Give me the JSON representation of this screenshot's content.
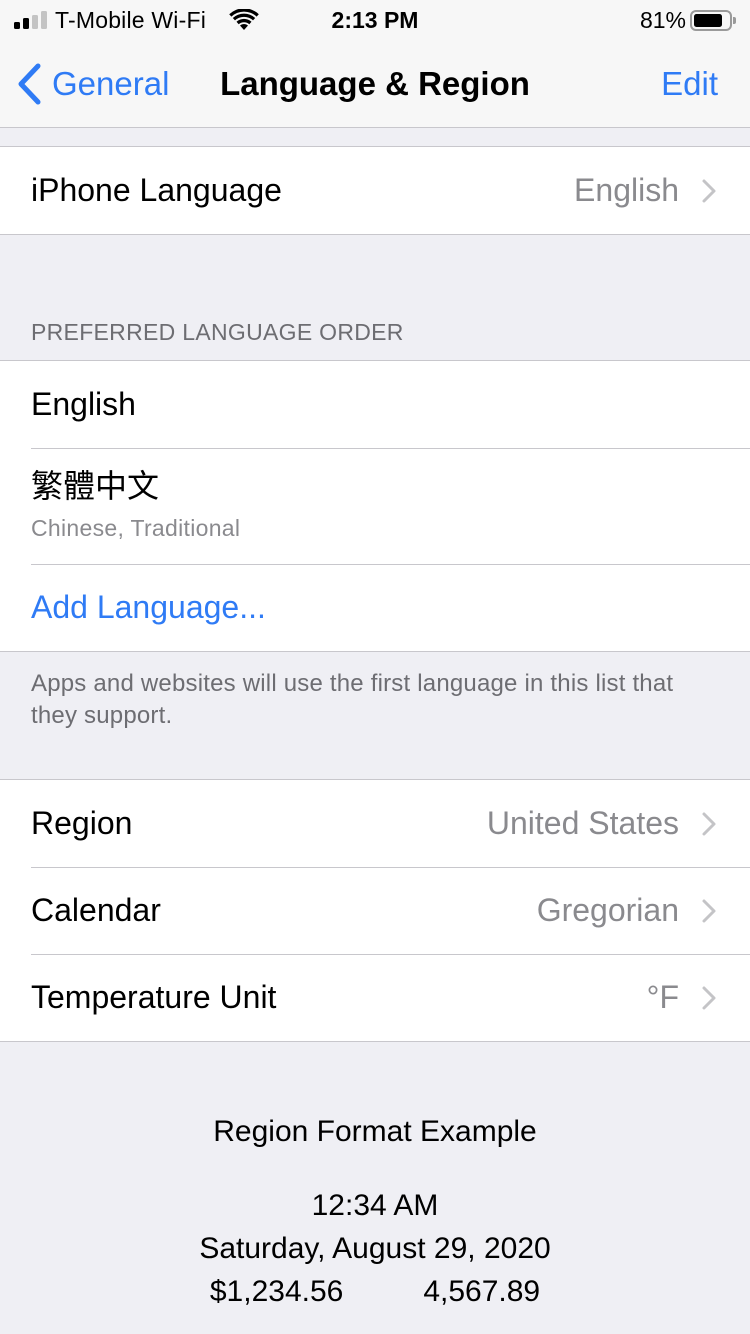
{
  "status_bar": {
    "carrier": "T-Mobile Wi-Fi",
    "time": "2:13 PM",
    "battery_percent": "81%",
    "battery_level": 0.81
  },
  "nav": {
    "back_label": "General",
    "title": "Language & Region",
    "edit_label": "Edit"
  },
  "iphone_language": {
    "label": "iPhone Language",
    "value": "English"
  },
  "preferred_order": {
    "header": "PREFERRED LANGUAGE ORDER",
    "languages": [
      {
        "name": "English"
      },
      {
        "name": "繁體中文",
        "subtitle": "Chinese, Traditional"
      }
    ],
    "add_label": "Add Language...",
    "footer": "Apps and websites will use the first language in this list that they support."
  },
  "region_settings": [
    {
      "label": "Region",
      "value": "United States"
    },
    {
      "label": "Calendar",
      "value": "Gregorian"
    },
    {
      "label": "Temperature Unit",
      "value": "°F"
    }
  ],
  "region_format_example": {
    "title": "Region Format Example",
    "time": "12:34 AM",
    "date": "Saturday, August 29, 2020",
    "currency": "$1,234.56",
    "number": "4,567.89"
  },
  "colors": {
    "accent": "#2f7bf5",
    "background": "#efeff4",
    "secondary_text": "#8a8a8e"
  }
}
